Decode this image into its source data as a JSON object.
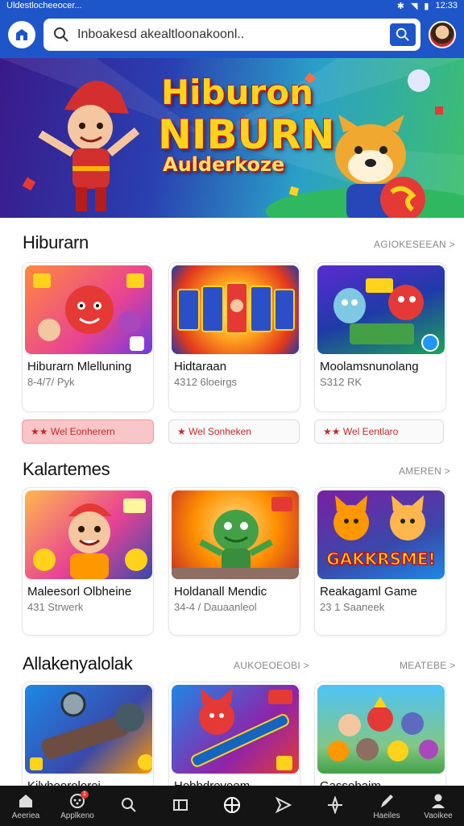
{
  "status": {
    "left_text": "Uldestlocheeocer...",
    "time": "12:33"
  },
  "search": {
    "value": "Inboakesd akealtloonakoonl.."
  },
  "banner": {
    "line1": "Hiburon",
    "line2": "NIBURN",
    "line3": "Aulderkoze"
  },
  "sections": [
    {
      "title": "Hiburarn",
      "link": "AGIOKESEEAN >",
      "cards": [
        {
          "name": "Hiburarn Mlelluning",
          "meta": "8-4/7/ Pyk"
        },
        {
          "name": "Hidtaraan",
          "meta": "4312 6loeirgs"
        },
        {
          "name": "Moolamsnunolang",
          "meta": "S312 RK"
        }
      ],
      "chips": [
        {
          "label": "★★ Wel Eonherern"
        },
        {
          "label": "★ Wel Sonheken"
        },
        {
          "label": "★★ Wel Eentlaro"
        }
      ]
    },
    {
      "title": "Kalartemes",
      "link": "AMEREN >",
      "cards": [
        {
          "name": "Maleesorl Olbheine",
          "meta": "431 Strwerk"
        },
        {
          "name": "Holdanall Mendic",
          "meta": "34-4 / Dauaanleol"
        },
        {
          "name": "Reakagaml Game",
          "meta": "23 1 Saaneek"
        }
      ]
    },
    {
      "title": "Allakenyalolak",
      "link": "AUKOEOEOBI >",
      "link2": "MEATEBE >",
      "cards": [
        {
          "name": "Kilvheorolerei"
        },
        {
          "name": "Hobbdreveem"
        },
        {
          "name": "Gassebaim"
        }
      ]
    }
  ],
  "thumb_text": {
    "s2c3": "GAKKRSME!"
  },
  "nav": [
    {
      "label": "Aeeriea",
      "icon": "home-icon"
    },
    {
      "label": "Applkeno",
      "icon": "gamepad-icon",
      "badge": "1"
    },
    {
      "label": "",
      "icon": "search-icon"
    },
    {
      "label": "",
      "icon": "library-icon"
    },
    {
      "label": "",
      "icon": "grid-circle-icon"
    },
    {
      "label": "",
      "icon": "send-icon"
    },
    {
      "label": "",
      "icon": "compass-icon"
    },
    {
      "label": "Haeiles",
      "icon": "brush-icon"
    },
    {
      "label": "Vaoikee",
      "icon": "profile-icon"
    }
  ],
  "colors": {
    "brand_blue": "#1e55c8",
    "accent_red": "#e53935",
    "chip_active": "#f8c6c8"
  }
}
